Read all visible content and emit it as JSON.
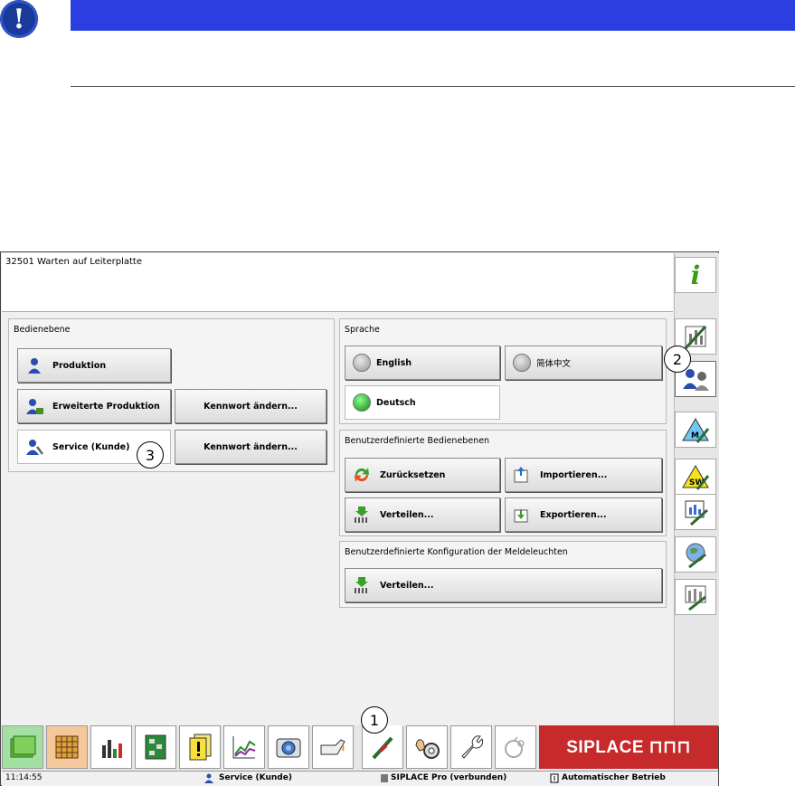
{
  "manual": {
    "warning_glyph": "!"
  },
  "message_bar": {
    "text": "32501 Warten auf Leiterplatte"
  },
  "bedienebene": {
    "title": "Bedienebene",
    "buttons": [
      {
        "label": "Produktion",
        "icon": "user-icon"
      },
      {
        "label": "Erweiterte Produktion",
        "icon": "user-advanced-icon"
      },
      {
        "label": "Service (Kunde)",
        "icon": "user-service-icon"
      }
    ],
    "password_button_label": "Kennwort ändern..."
  },
  "sprache": {
    "title": "Sprache",
    "options": [
      {
        "label": "English",
        "selected": false
      },
      {
        "label": "简体中文",
        "selected": false
      },
      {
        "label": "Deutsch",
        "selected": true
      }
    ]
  },
  "custom_levels": {
    "title": "Benutzerdefinierte Bedienebenen",
    "buttons": [
      "Zurücksetzen",
      "Importieren...",
      "Verteilen...",
      "Exportieren..."
    ]
  },
  "custom_config": {
    "title": "Benutzerdefinierte Konfiguration der Meldeleuchten",
    "button": "Verteilen..."
  },
  "callouts": [
    "1",
    "2",
    "3"
  ],
  "taskbar": {
    "brand": "SIPLACE ⊓⊓⊓"
  },
  "status": {
    "time": "11:14:55",
    "user": "Service (Kunde)",
    "connection": "SIPLACE Pro (verbunden)",
    "mode": "Automatischer Betrieb"
  },
  "colors": {
    "brand_red": "#c62a2a",
    "header_blue": "#2b3fe0"
  }
}
